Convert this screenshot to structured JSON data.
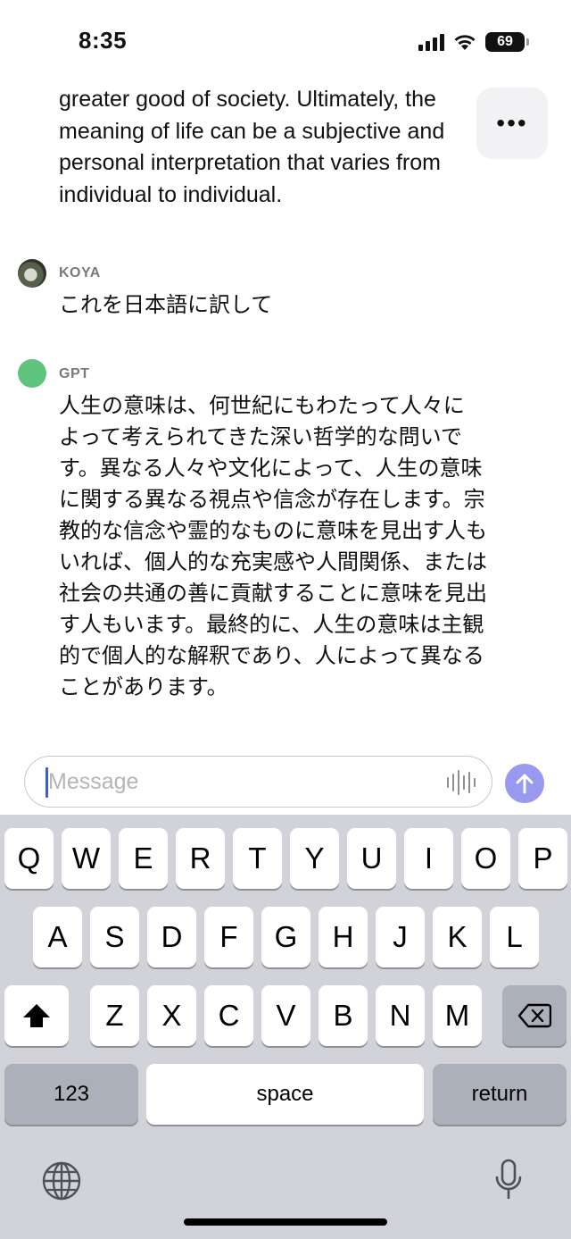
{
  "status_bar": {
    "time": "8:35",
    "battery_level": "69"
  },
  "chat": {
    "previous_reply_lines": [
      "greater good of society. Ultimately, the",
      "meaning of life can be a subjective and",
      "personal interpretation that varies from",
      "individual to individual."
    ],
    "more_button_label": "•••",
    "user_message": {
      "sender": "KOYA",
      "text": "これを日本語に訳して"
    },
    "assistant_message": {
      "sender": "GPT",
      "lines": [
        "人生の意味は、何世紀にもわたって人々に",
        "よって考えられてきた深い哲学的な問いで",
        "す。異なる人々や文化によって、人生の意味",
        "に関する異なる視点や信念が存在します。宗",
        "教的な信念や霊的なものに意味を見出す人も",
        "いれば、個人的な充実感や人間関係、または",
        "社会の共通の善に貢献することに意味を見出",
        "す人もいます。最終的に、人生の意味は主観",
        "的で個人的な解釈であり、人によって異なる",
        "ことがあります。"
      ]
    }
  },
  "composer": {
    "placeholder": "Message",
    "send_color": "#9a99f0"
  },
  "keyboard": {
    "row1": [
      "Q",
      "W",
      "E",
      "R",
      "T",
      "Y",
      "U",
      "I",
      "O",
      "P"
    ],
    "row2": [
      "A",
      "S",
      "D",
      "F",
      "G",
      "H",
      "J",
      "K",
      "L"
    ],
    "row3": [
      "Z",
      "X",
      "C",
      "V",
      "B",
      "N",
      "M"
    ],
    "numbers_label": "123",
    "space_label": "space",
    "return_label": "return",
    "icons": {
      "shift": "shift-icon",
      "delete": "delete-icon",
      "globe": "globe-icon",
      "mic": "microphone-icon"
    }
  }
}
